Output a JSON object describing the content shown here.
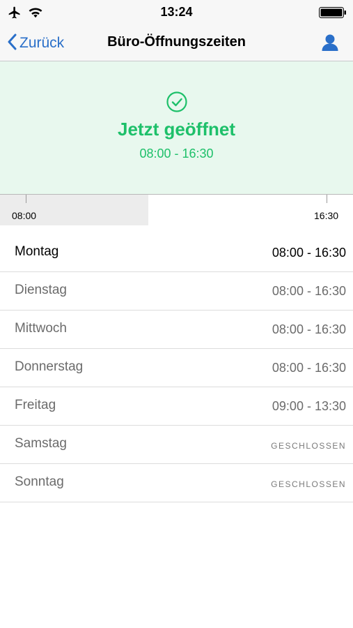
{
  "status_bar": {
    "time": "13:24",
    "icons": [
      "airplane-icon",
      "wifi-icon",
      "battery-icon"
    ]
  },
  "nav": {
    "back_label": "Zurück",
    "title": "Büro-Öffnungszeiten",
    "back_icon": "chevron-left-icon",
    "profile_icon": "user-icon"
  },
  "status": {
    "icon": "check-circle-icon",
    "title": "Jetzt geöffnet",
    "hours": "08:00 - 16:30"
  },
  "timeline": {
    "start_label": "08:00",
    "end_label": "16:30",
    "elapsed_fraction": 0.42
  },
  "days": [
    {
      "name": "Montag",
      "hours": "08:00 - 16:30",
      "current": true,
      "closed": false
    },
    {
      "name": "Dienstag",
      "hours": "08:00 - 16:30",
      "current": false,
      "closed": false
    },
    {
      "name": "Mittwoch",
      "hours": "08:00 - 16:30",
      "current": false,
      "closed": false
    },
    {
      "name": "Donnerstag",
      "hours": "08:00 - 16:30",
      "current": false,
      "closed": false
    },
    {
      "name": "Freitag",
      "hours": "09:00 - 13:30",
      "current": false,
      "closed": false
    },
    {
      "name": "Samstag",
      "hours": "GESCHLOSSEN",
      "current": false,
      "closed": true
    },
    {
      "name": "Sonntag",
      "hours": "GESCHLOSSEN",
      "current": false,
      "closed": true
    }
  ],
  "colors": {
    "accent": "#2a6fc9",
    "open_green": "#1ec06a",
    "banner_bg": "#e8f8ee"
  }
}
